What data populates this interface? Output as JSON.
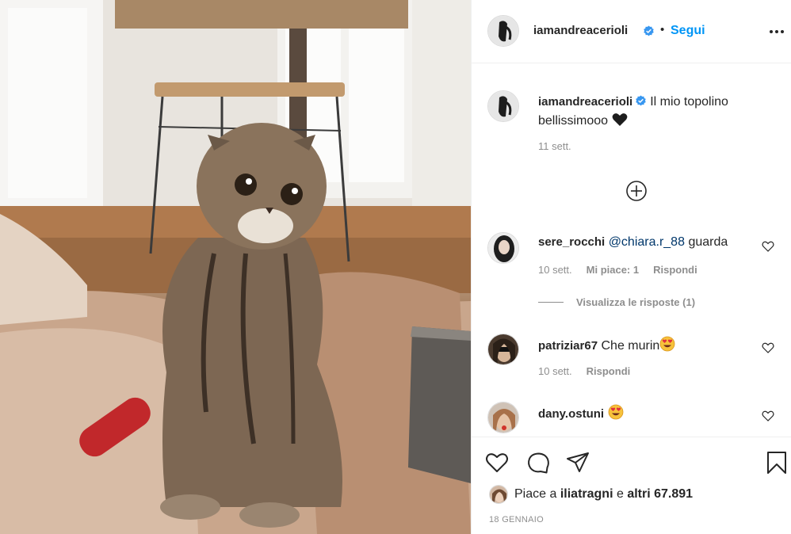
{
  "post": {
    "author": "iamandreacerioli",
    "follow_label": "Segui",
    "caption": {
      "username": "iamandreacerioli",
      "text": "Il mio topolino bellissimooo",
      "emoji": "black-heart-emoji",
      "time": "11 sett."
    },
    "comments": [
      {
        "username": "sere_rocchi",
        "mention": "@chiara.r_88",
        "text": "guarda",
        "time": "10 sett.",
        "likes": "Mi piace: 1",
        "reply_label": "Rispondi",
        "view_replies": "Visualizza le risposte (1)"
      },
      {
        "username": "patriziar67",
        "text": "Che murin",
        "emoji": "heart-eyes-emoji",
        "time": "10 sett.",
        "reply_label": "Rispondi"
      },
      {
        "username": "dany.ostuni",
        "text": "",
        "emoji": "heart-eyes-emoji"
      }
    ],
    "likes_line": {
      "prefix": "Piace a",
      "user": "iliatragni",
      "conjunction": "e",
      "others": "altri 67.891"
    },
    "date": "18 GENNAIO"
  },
  "colors": {
    "accent": "#0095f6",
    "verified": "#3897f0",
    "text": "#262626",
    "muted": "#8e8e8e",
    "mention": "#00376b"
  },
  "icons": [
    "more-options-icon",
    "verified-badge-icon",
    "add-comment-circle-icon",
    "heart-icon",
    "comment-icon",
    "share-icon",
    "bookmark-icon"
  ]
}
